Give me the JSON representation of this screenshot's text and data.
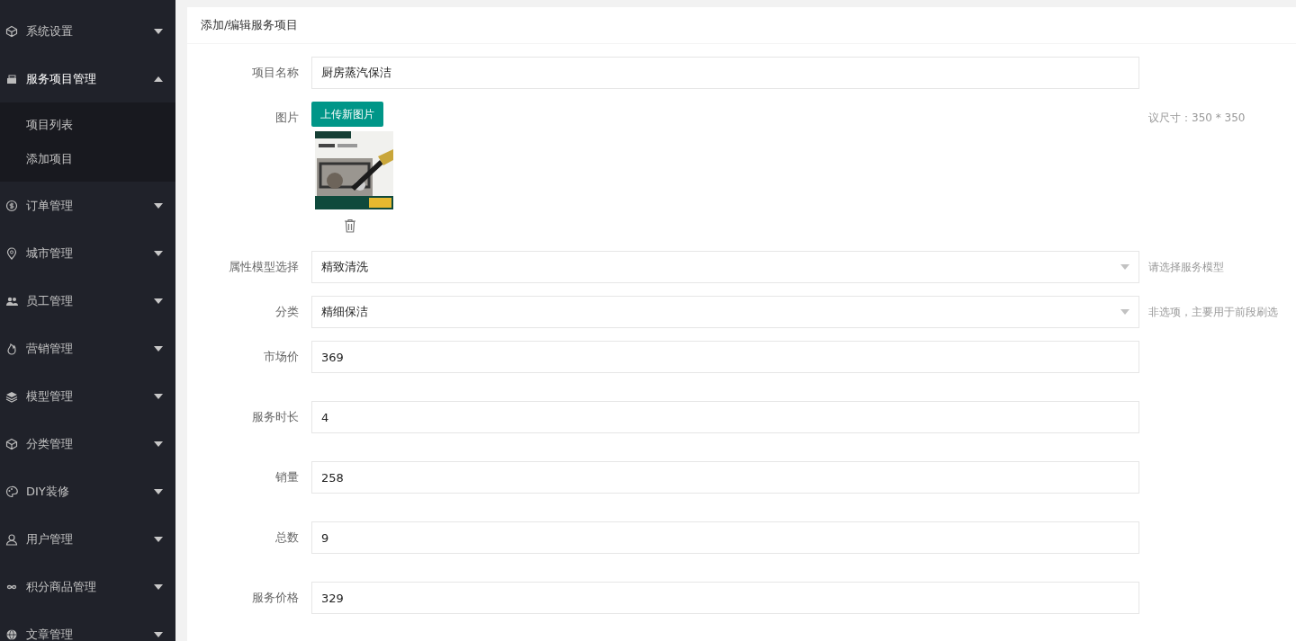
{
  "sidebar": {
    "items": [
      {
        "label": "系统设置",
        "expanded": false
      },
      {
        "label": "服务项目管理",
        "expanded": true,
        "children": [
          {
            "label": "项目列表",
            "selected": false
          },
          {
            "label": "添加项目",
            "selected": false
          }
        ]
      },
      {
        "label": "订单管理",
        "expanded": false
      },
      {
        "label": "城市管理",
        "expanded": false
      },
      {
        "label": "员工管理",
        "expanded": false
      },
      {
        "label": "营销管理",
        "expanded": false
      },
      {
        "label": "模型管理",
        "expanded": false
      },
      {
        "label": "分类管理",
        "expanded": false
      },
      {
        "label": "DIY装修",
        "expanded": false
      },
      {
        "label": "用户管理",
        "expanded": false
      },
      {
        "label": "积分商品管理",
        "expanded": false
      },
      {
        "label": "文章管理",
        "expanded": false
      }
    ]
  },
  "form": {
    "title": "添加/编辑服务项目",
    "fields": [
      {
        "kind": "text",
        "label": "项目名称",
        "value": "厨房蒸汽保洁"
      },
      {
        "label": "图片",
        "button": "上传新图片",
        "hint": "议尺寸：350 * 350"
      },
      {
        "kind": "select",
        "label": "属性模型选择",
        "value": "精致清洗",
        "hint": "请选择服务模型"
      },
      {
        "kind": "select",
        "label": "分类",
        "value": "精细保洁",
        "hint": "非选项，主要用于前段刷选"
      },
      {
        "kind": "text",
        "label": "市场价",
        "value": "369"
      },
      {
        "kind": "text",
        "label": "服务时长",
        "value": "4"
      },
      {
        "kind": "text",
        "label": "销量",
        "value": "258"
      },
      {
        "kind": "text",
        "label": "总数",
        "value": "9"
      },
      {
        "kind": "text",
        "label": "服务价格",
        "value": "329"
      }
    ]
  }
}
